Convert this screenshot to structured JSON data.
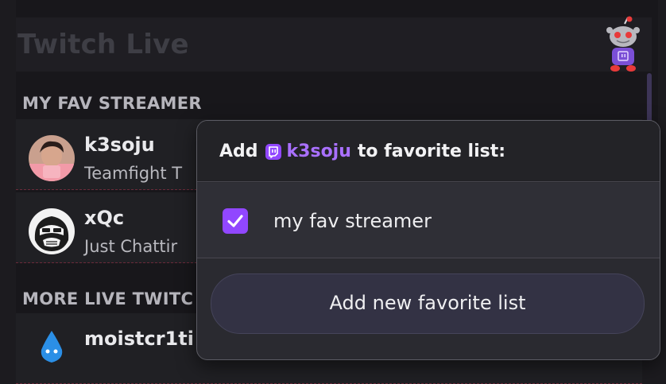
{
  "app": {
    "title": "Twitch Live"
  },
  "sections": {
    "favorites_label": "MY FAV STREAMER",
    "more_label": "MORE LIVE TWITC"
  },
  "streamers": [
    {
      "name": "k3soju",
      "game": "Teamfight T"
    },
    {
      "name": "xQc",
      "game": "Just Chattir"
    },
    {
      "name": "moistcr1ti"
    }
  ],
  "popover": {
    "title_prefix": "Add",
    "streamer": "k3soju",
    "title_suffix": "to favorite list:",
    "lists": [
      {
        "label": "my fav streamer",
        "checked": true
      }
    ],
    "add_button_label": "Add new favorite list"
  },
  "colors": {
    "accent": "#9147ff",
    "streamer_link": "#a970ff",
    "background": "#18171b"
  }
}
